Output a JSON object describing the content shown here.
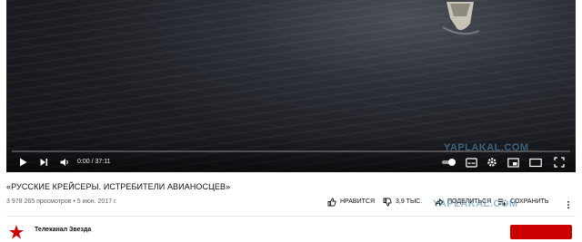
{
  "player": {
    "time_display": "0:00 / 37:11",
    "progress": 0.0,
    "accent": "#ff0000",
    "controls": {
      "left": [
        "play-icon",
        "next-icon",
        "volume-icon"
      ],
      "right": [
        "autoplay-toggle",
        "subtitles-icon",
        "settings-icon",
        "miniplayer-icon",
        "theater-icon",
        "fullscreen-icon"
      ]
    }
  },
  "video": {
    "title": "«РУССКИЕ КРЕЙСЕРЫ. ИСТРЕБИТЕЛИ АВИАНОСЦЕВ»",
    "meta": "3 978 265 просмотров • 5 июн. 2017 г."
  },
  "actions": {
    "like_label": "НРАВИТСЯ",
    "dislike_count": "3,9 ТЫС.",
    "share_label": "ПОДЕЛИТЬСЯ",
    "save_label": "СОХРАНИТЬ"
  },
  "channel": {
    "name": "Телеканал Звезда"
  },
  "watermark": {
    "text": "YAPLAKAL.COM",
    "color": "#3c82aa"
  },
  "subscribe": {
    "color": "#cc0000"
  }
}
